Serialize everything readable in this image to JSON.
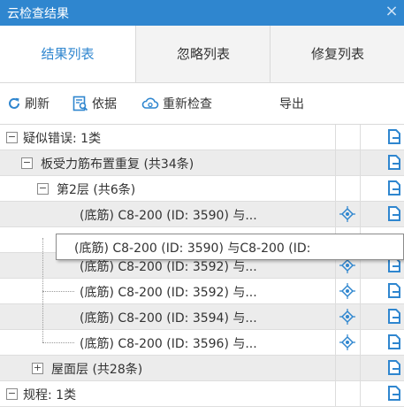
{
  "window": {
    "title": "云检查结果",
    "close_symbol": "×"
  },
  "tabs": [
    {
      "label": "结果列表",
      "active": true
    },
    {
      "label": "忽略列表",
      "active": false
    },
    {
      "label": "修复列表",
      "active": false
    }
  ],
  "toolbar": {
    "refresh": "刷新",
    "basis": "依据",
    "recheck": "重新检查",
    "export": "导出"
  },
  "tree": {
    "suspect_errors": {
      "label": "疑似错误: 1类",
      "expander": "−"
    },
    "duplicate_rebar": {
      "label": "板受力筋布置重复 (共34条)",
      "expander": "−"
    },
    "floor2": {
      "label": "第2层 (共6条)",
      "expander": "−"
    },
    "items": [
      "(底筋) C8-200 (ID: 3590) 与...",
      "",
      "(底筋) C8-200 (ID: 3592) 与...",
      "(底筋) C8-200 (ID: 3592) 与...",
      "(底筋) C8-200 (ID: 3594) 与...",
      "(底筋) C8-200 (ID: 3596) 与..."
    ],
    "roof": {
      "label": "屋面层 (共28条)",
      "expander": "+"
    },
    "next_partial": {
      "label": "规程: 1类",
      "expander": "−"
    }
  },
  "tooltip": {
    "text": "(底筋) C8-200 (ID: 3590) 与C8-200 (ID:"
  },
  "colors": {
    "accent": "#2f86cf",
    "titlebar": "#2f86cf"
  }
}
